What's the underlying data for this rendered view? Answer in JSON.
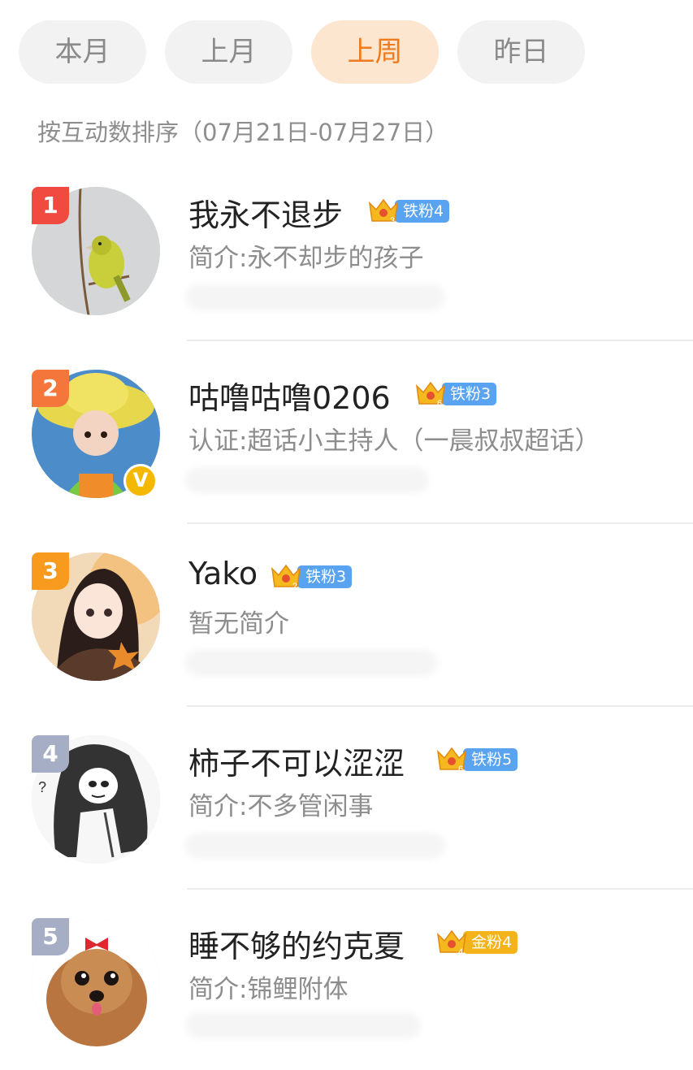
{
  "tabs": [
    {
      "label": "本月",
      "active": false
    },
    {
      "label": "上月",
      "active": false
    },
    {
      "label": "上周",
      "active": true
    },
    {
      "label": "昨日",
      "active": false
    }
  ],
  "tab_more_glyph": "▕",
  "sort_caption": "按互动数排序（07月21日-07月27日）",
  "colors": {
    "accent": "#f07b1e",
    "tab_active_bg": "#fde6cf",
    "rank_1": "#f04a41",
    "rank_2": "#f4763a",
    "rank_3": "#f79a1e",
    "rank_other": "#a5aec4",
    "iron_fan": "#5aa3f0",
    "gold_fan": "#f5b31b"
  },
  "users": [
    {
      "rank": "1",
      "name": "我永不退步",
      "crown_level": "3",
      "fan_label": "铁粉4",
      "fan_type": "iron",
      "bio": "简介:永不却步的孩子",
      "verified": false,
      "avatar": "green-bird-avatar"
    },
    {
      "rank": "2",
      "name": "咕噜咕噜0206",
      "crown_level": "6",
      "fan_label": "铁粉3",
      "fan_type": "iron",
      "bio": "认证:超话小主持人（一晨叔叔超话）",
      "verified": true,
      "verified_glyph": "V",
      "avatar": "doll-straw-hat-avatar"
    },
    {
      "rank": "3",
      "name": "Yako",
      "crown_level": "2",
      "fan_label": "铁粉3",
      "fan_type": "iron",
      "bio": "暂无简介",
      "verified": false,
      "avatar": "anime-girl-avatar"
    },
    {
      "rank": "4",
      "name": "柿子不可以涩涩",
      "crown_level": "6",
      "fan_label": "铁粉5",
      "fan_type": "iron",
      "bio": "简介:不多管闲事",
      "verified": false,
      "avatar": "sketch-girl-avatar"
    },
    {
      "rank": "5",
      "name": "睡不够的约克夏",
      "crown_level": "4",
      "fan_label": "金粉4",
      "fan_type": "gold",
      "bio": "简介:锦鲤附体",
      "verified": false,
      "avatar": "yorkshire-dog-avatar"
    }
  ]
}
